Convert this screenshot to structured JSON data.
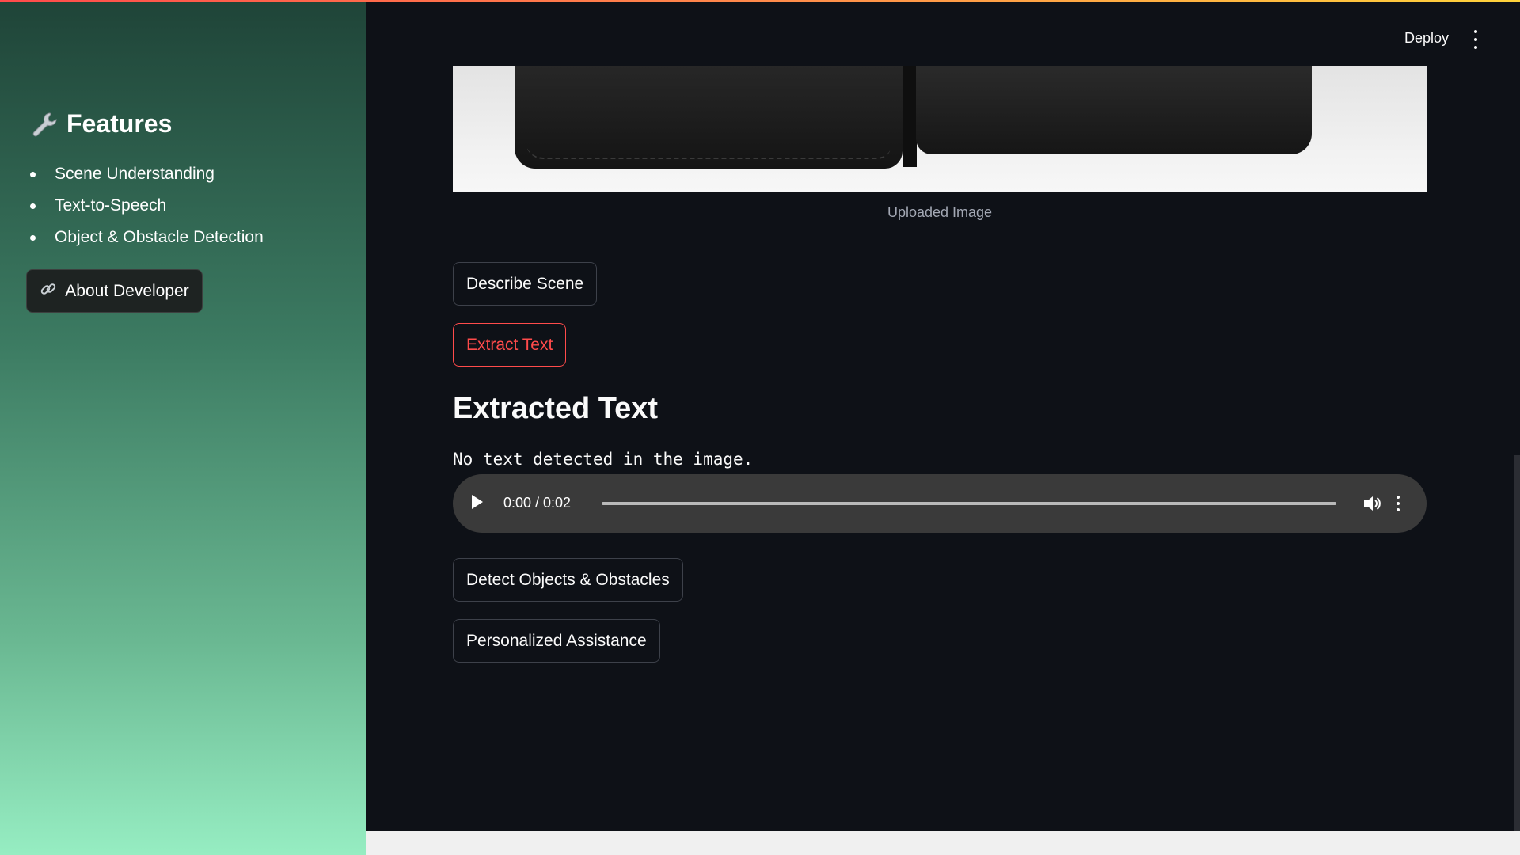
{
  "sidebar": {
    "title": "Features",
    "icon": "wrench-icon",
    "features": [
      "Scene Understanding",
      "Text-to-Speech",
      "Object & Obstacle Detection"
    ],
    "about_button": {
      "label": "About Developer",
      "icon": "link-icon"
    }
  },
  "header": {
    "deploy_label": "Deploy",
    "menu_icon": "kebab-menu-icon"
  },
  "main": {
    "image_caption": "Uploaded Image",
    "buttons": {
      "describe_scene": "Describe Scene",
      "extract_text": "Extract Text",
      "detect_objects": "Detect Objects & Obstacles",
      "personalized_assistance": "Personalized Assistance"
    },
    "extracted_heading": "Extracted Text",
    "extracted_result": "No text detected in the image.",
    "audio": {
      "time": "0:00 / 0:02"
    }
  },
  "colors": {
    "accent": "#ff4b4b",
    "background": "#0e1117",
    "sidebar_top": "#1f4438",
    "sidebar_bottom": "#96edc2"
  }
}
